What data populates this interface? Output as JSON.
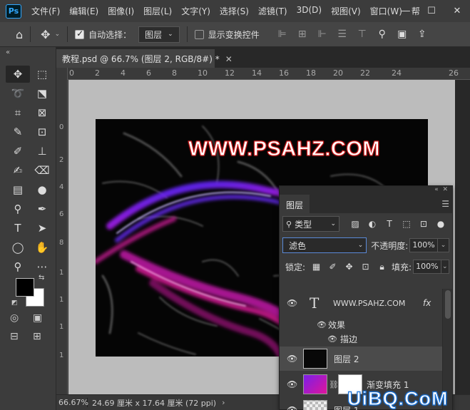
{
  "menubar": {
    "logo": "Ps",
    "items": [
      "文件(F)",
      "编辑(E)",
      "图像(I)",
      "图层(L)",
      "文字(Y)",
      "选择(S)",
      "滤镜(T)",
      "3D(D)",
      "视图(V)",
      "窗口(W)",
      "帮"
    ],
    "minimize": "—",
    "maximize": "☐",
    "close": "✕"
  },
  "options": {
    "auto_select_label": "自动选择：",
    "auto_select_value": "图层",
    "show_transform_label": "显示变换控件"
  },
  "document": {
    "tab_title": "教程.psd @ 66.7% (图层 2, RGB/8#) *",
    "close": "✕",
    "artwork_text": "WWW.PSAHZ.COM"
  },
  "rulers": {
    "h_ticks": [
      "0",
      "2",
      "4",
      "6",
      "8",
      "10",
      "12",
      "14",
      "16",
      "18",
      "20",
      "22",
      "24",
      "26"
    ],
    "v_ticks": [
      "0",
      "2",
      "4",
      "6",
      "8",
      "1",
      "1",
      "1",
      "1"
    ]
  },
  "status": {
    "zoom": "66.67%",
    "info": "24.69 厘米 x 17.64 厘米 (72 ppi)",
    "arrow": "›"
  },
  "layers_panel": {
    "tab": "图层",
    "kind_label": "类型",
    "blend_mode": "滤色",
    "opacity_label": "不透明度:",
    "opacity_value": "100%",
    "lock_label": "锁定:",
    "fill_label": "填充:",
    "fill_value": "100%",
    "layers": [
      {
        "name": "WWW.PSAHZ.COM",
        "type": "text",
        "fx": "fx"
      },
      {
        "name": "效果",
        "type": "effects"
      },
      {
        "name": "描边",
        "type": "effect-item"
      },
      {
        "name": "图层 2",
        "type": "pixel",
        "selected": true
      },
      {
        "name": "渐变填充 1",
        "type": "fill"
      },
      {
        "name": "图层 1",
        "type": "pixel"
      }
    ]
  },
  "watermark": "UiBQ.CoM",
  "colors": {
    "foreground": "#000000",
    "background": "#ffffff",
    "text_stroke": "#d21a1a",
    "watermark": "#1a73d9"
  }
}
